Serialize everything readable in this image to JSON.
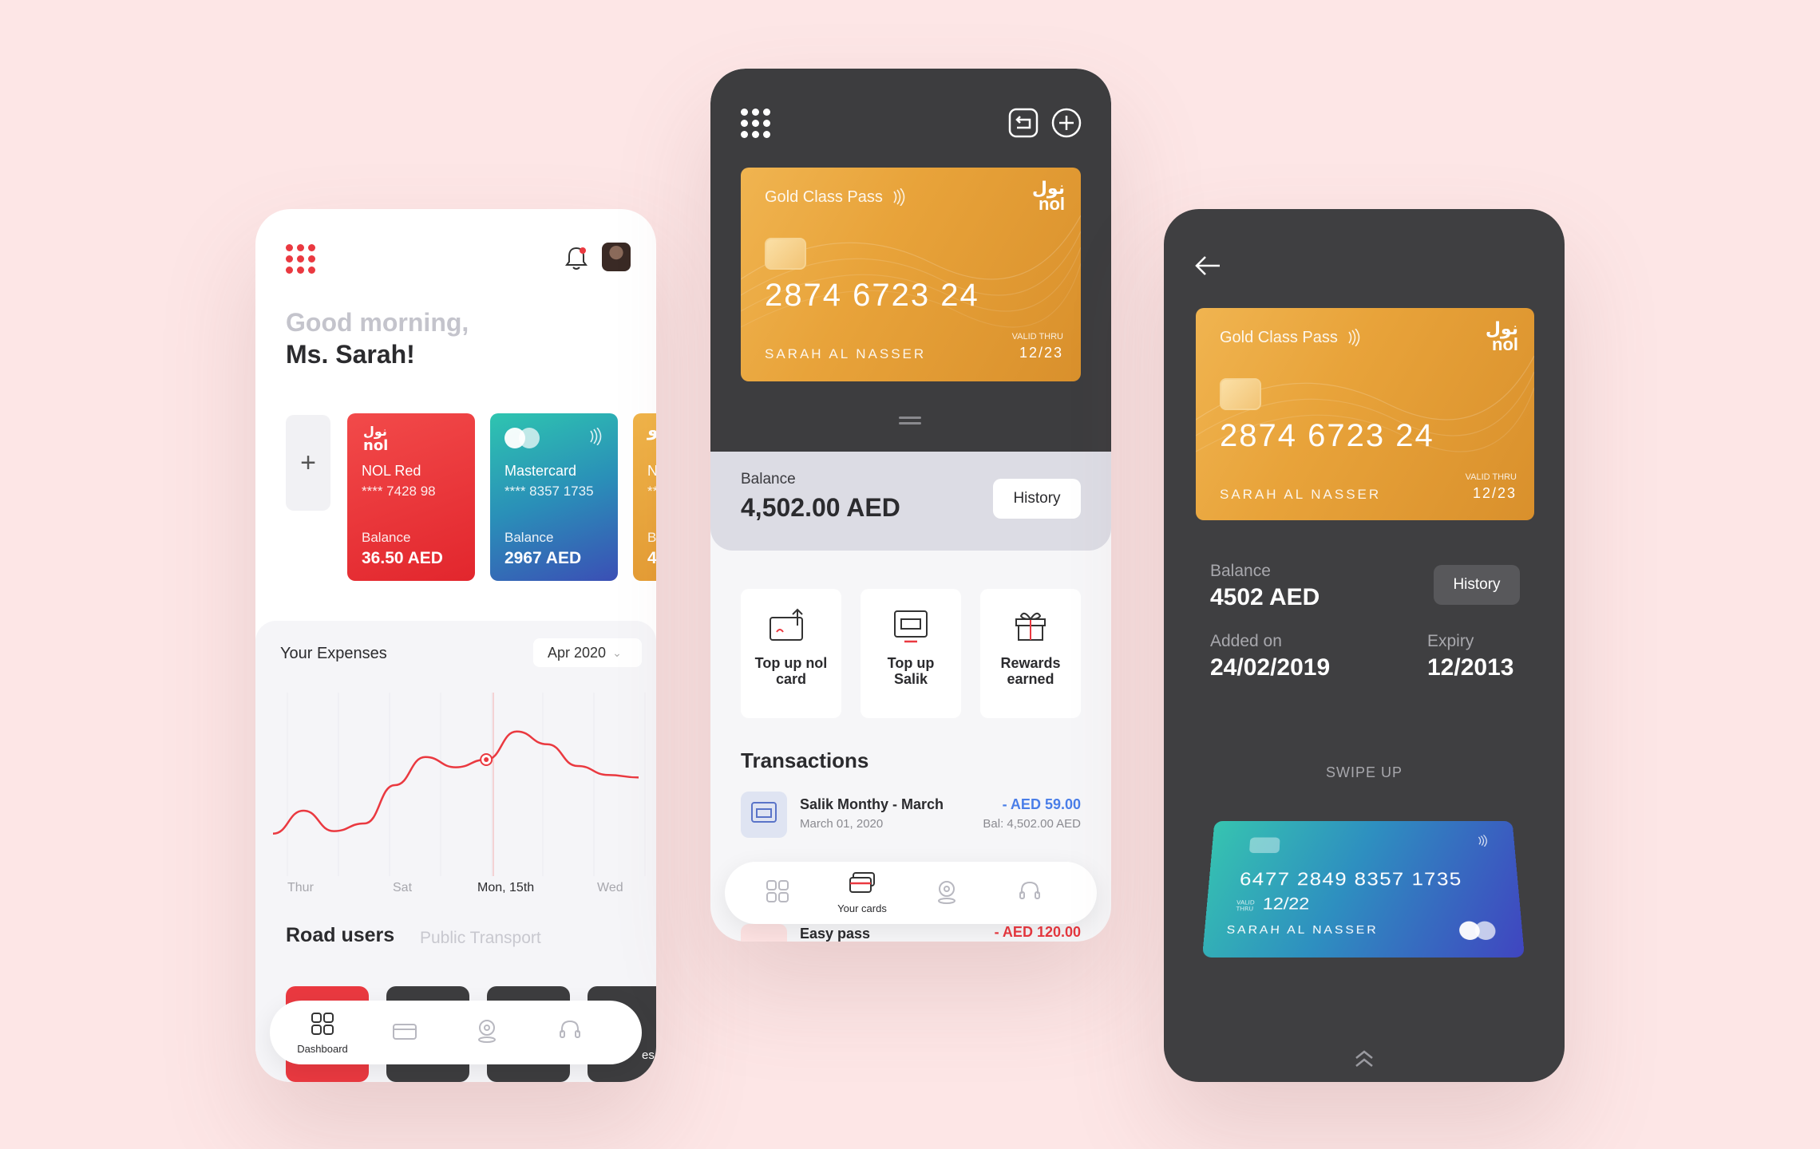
{
  "phone1": {
    "greeting_line1": "Good morning,",
    "greeting_line2": "Ms. Sarah!",
    "add_card_symbol": "+",
    "cards": [
      {
        "logo": "نول\nnol",
        "name": "NOL Red",
        "number": "**** 7428 98",
        "balance_label": "Balance",
        "balance": "36.50 AED"
      },
      {
        "name": "Mastercard",
        "number": "**** 8357 1735",
        "balance_label": "Balance",
        "balance": "2967 AED"
      },
      {
        "logo": "نو",
        "name": "N",
        "number": "**",
        "balance_label": "B",
        "balance": "4"
      }
    ],
    "expenses": {
      "title": "Your Expenses",
      "month": "Apr 2020",
      "x_labels": [
        "Thur",
        "Sat",
        "Mon, 15th",
        "Wed"
      ]
    },
    "chart_data": {
      "type": "line",
      "title": "Your Expenses",
      "categories": [
        "Thur",
        "Sat",
        "Mon, 15th",
        "Wed"
      ],
      "series": [
        {
          "values": [
            0.02,
            0.2,
            0.04,
            0.1,
            0.4,
            0.62,
            0.54,
            0.6,
            0.82,
            0.72,
            0.55,
            0.48,
            0.46
          ]
        }
      ],
      "highlighted_category": "Mon, 15th",
      "color": "#ea3940"
    },
    "road": {
      "tab_active": "Road users",
      "tab_inactive": "Public Transport",
      "tile_partial_label": "es"
    },
    "nav": {
      "dashboard_label": "Dashboard"
    },
    "colors": {
      "accent": "#ea3940"
    }
  },
  "phone2": {
    "card": {
      "name": "Gold Class Pass",
      "logo": "نول\nnol",
      "number": "2874 6723 24",
      "holder": "SARAH AL NASSER",
      "valid_thru_label": "VALID THRU",
      "expiry": "12/23"
    },
    "balance": {
      "label": "Balance",
      "value": "4,502.00 AED",
      "history_button": "History"
    },
    "actions": [
      {
        "label_line1": "Top up nol",
        "label_line2": "card",
        "icon": "top-up-nol-card-icon"
      },
      {
        "label_line1": "Top up",
        "label_line2": "Salik",
        "icon": "top-up-salik-icon"
      },
      {
        "label_line1": "Rewards",
        "label_line2": "earned",
        "icon": "rewards-gift-icon"
      }
    ],
    "transactions_title": "Transactions",
    "transactions": [
      {
        "name": "Salik Monthy - March",
        "date": "March 01, 2020",
        "amount": "- AED 59.00",
        "balance": "Bal: 4,502.00 AED"
      },
      {
        "name": "Easy pass",
        "amount": "- AED 120.00"
      }
    ],
    "nav": {
      "your_cards_label": "Your cards"
    }
  },
  "phone3": {
    "card": {
      "name": "Gold Class Pass",
      "logo": "نول\nnol",
      "number": "2874 6723 24",
      "holder": "SARAH AL NASSER",
      "valid_thru_label": "VALID THRU",
      "expiry": "12/23"
    },
    "balance_label": "Balance",
    "balance_value": "4502 AED",
    "history_button": "History",
    "added_on_label": "Added on",
    "added_on_value": "24/02/2019",
    "expiry_label": "Expiry",
    "expiry_value": "12/2013",
    "swipe_label": "SWIPE UP",
    "blue_card": {
      "number": "6477 2849 8357 1735",
      "valid_thru_label": "VALID\nTHRU",
      "expiry": "12/22",
      "holder": "SARAH AL NASSER"
    }
  }
}
